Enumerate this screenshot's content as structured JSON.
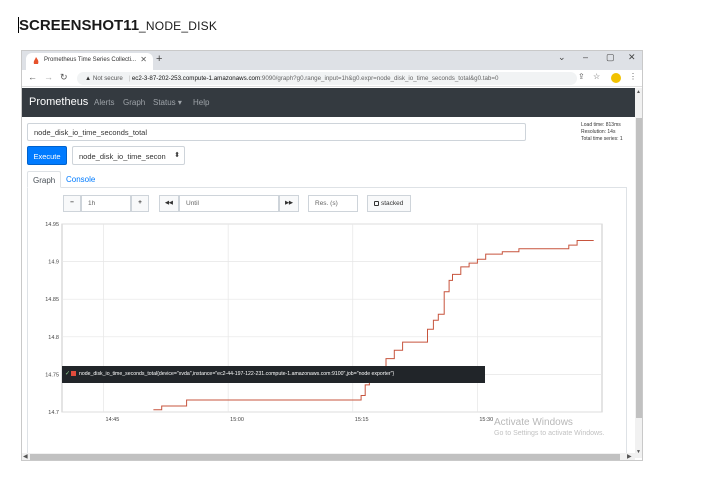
{
  "doc_title": {
    "big": "SCREENSHOT11",
    "small": "_NODE_DISK"
  },
  "browser": {
    "tab_title": "Prometheus Time Series Collecti...",
    "new_tab": "+",
    "window_controls": {
      "minimize": "⌄",
      "restore": "–",
      "maximize": "▢",
      "close": "✕"
    },
    "not_secure": "Not secure",
    "url_host": "ec2-3-87-202-253.compute-1.amazonaws.com",
    "url_path": ":9090/graph?g0.range_input=1h&g0.expr=node_disk_io_time_seconds_total&g0.tab=0"
  },
  "nav": {
    "brand": "Prometheus",
    "links": [
      "Alerts",
      "Graph",
      "Status ▾",
      "Help"
    ]
  },
  "query": {
    "expression": "node_disk_io_time_seconds_total",
    "execute_label": "Execute",
    "metric_select": "node_disk_io_time_secon",
    "stats": [
      "Load time: 813ms",
      "Resolution: 14s",
      "Total time series: 1"
    ]
  },
  "tabs": {
    "graph": "Graph",
    "console": "Console"
  },
  "controls": {
    "minus": "−",
    "range": "1h",
    "plus": "+",
    "back": "◀◀",
    "until_placeholder": "Until",
    "forward": "▶▶",
    "res_placeholder": "Res. (s)",
    "stacked": "stacked"
  },
  "chart_data": {
    "type": "line",
    "title": "",
    "xlabel": "",
    "ylabel": "",
    "x_ticks": [
      "14:45",
      "15:00",
      "15:15",
      "15:30"
    ],
    "y_ticks": [
      14.7,
      14.75,
      14.8,
      14.85,
      14.9,
      14.95
    ],
    "ylim": [
      14.7,
      14.95
    ],
    "grid": true,
    "series": [
      {
        "name": "node_disk_io_time_seconds_total{device=\"xvda\",instance=\"ec2-44-197-122-231.compute-1.amazonaws.com:9100\",job=\"node exporter\"}",
        "color": "#c7543d",
        "points": [
          [
            "14:51",
            14.703
          ],
          [
            "14:52",
            14.708
          ],
          [
            "14:55",
            14.716
          ],
          [
            "15:15",
            14.716
          ],
          [
            "15:16",
            14.722
          ],
          [
            "15:16.5",
            14.736
          ],
          [
            "15:17",
            14.75
          ],
          [
            "15:18",
            14.757
          ],
          [
            "15:19",
            14.771
          ],
          [
            "15:20",
            14.782
          ],
          [
            "15:21",
            14.793
          ],
          [
            "15:23",
            14.793
          ],
          [
            "15:24",
            14.81
          ],
          [
            "15:24.7",
            14.822
          ],
          [
            "15:25.3",
            14.83
          ],
          [
            "15:26",
            14.86
          ],
          [
            "15:26.6",
            14.875
          ],
          [
            "15:27",
            14.883
          ],
          [
            "15:28",
            14.893
          ],
          [
            "15:29",
            14.898
          ],
          [
            "15:30",
            14.903
          ],
          [
            "15:31",
            14.91
          ],
          [
            "15:33",
            14.913
          ],
          [
            "15:35",
            14.917
          ],
          [
            "15:40",
            14.917
          ],
          [
            "15:41",
            14.922
          ],
          [
            "15:42",
            14.928
          ],
          [
            "15:44",
            14.928
          ]
        ]
      }
    ]
  },
  "legend_text": "node_disk_io_time_seconds_total{device=\"xvda\",instance=\"ec2-44-197-122-231.compute-1.amazonaws.com:9100\",job=\"node exporter\"}",
  "watermark": {
    "line1": "Activate Windows",
    "line2": "Go to Settings to activate Windows."
  }
}
